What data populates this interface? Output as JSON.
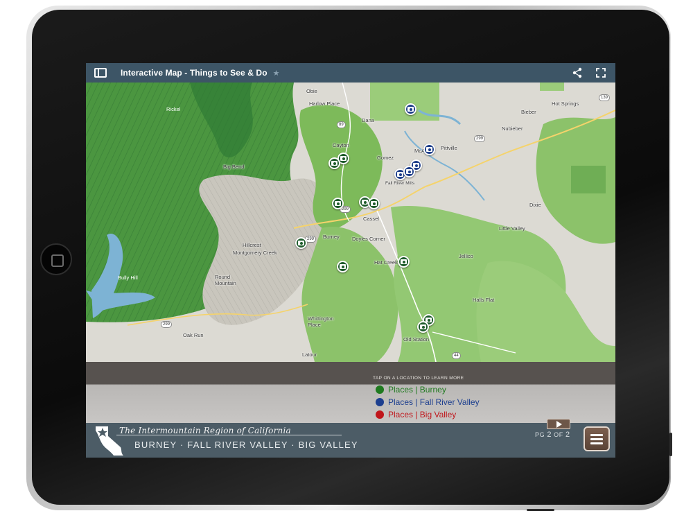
{
  "app": {
    "title": "Interactive Map - Things to See & Do"
  },
  "map": {
    "labels": {
      "obie": "Obie",
      "harlow_place": "Harlow Place",
      "rickel": "Rickel",
      "dana": "Dana",
      "bieber": "Bieber",
      "hot_springs": "Hot Springs",
      "nubieber": "Nubieber",
      "cayton": "Cayton",
      "gomez": "Gomez",
      "mcarthur": "McArthur",
      "pittville": "Pittville",
      "big_bend": "Big Bend",
      "fall_river_mills": "Fall River Mills",
      "cassel": "Cassel",
      "dixie": "Dixie",
      "little_valley": "Little Valley",
      "burney": "Burney",
      "doyles_corner": "Doyles Corner",
      "hillcrest": "Hillcrest",
      "montgomery_creek": "Montgomery Creek",
      "jellico": "Jellico",
      "hat_creek": "Hat Creek",
      "bully_hill": "Bully Hill",
      "round_mountain": "Round Mountain",
      "halls_flat": "Halls Flat",
      "whittington_place": "Whittington Place",
      "old_station": "Old Station",
      "oak_run": "Oak Run",
      "latour": "Latour"
    },
    "highways": {
      "h139": "139",
      "h299a": "299",
      "h299b": "299",
      "h299c": "299",
      "h299d": "299",
      "h89": "89",
      "h44": "44"
    }
  },
  "legend": {
    "hint": "TAP ON A LOCATION TO LEARN MORE",
    "items": [
      {
        "label": "Places | Burney",
        "color": "#1f7a1f"
      },
      {
        "label": "Places | Fall River Valley",
        "color": "#1d3f8f"
      },
      {
        "label": "Places | Big Valley",
        "color": "#c0161b"
      }
    ]
  },
  "footer": {
    "brand_script": "The Intermountain Region of California",
    "brand_towns": "BURNEY · FALL RIVER VALLEY · BIG VALLEY",
    "page_prefix": "PG",
    "page_current": "2",
    "page_of": "OF",
    "page_total": "2"
  },
  "colors": {
    "topbar": "#3d5566",
    "footer": "#4c5c66",
    "burney_pin": "#1d5b2a",
    "fall_river_pin": "#1f3f8a"
  }
}
